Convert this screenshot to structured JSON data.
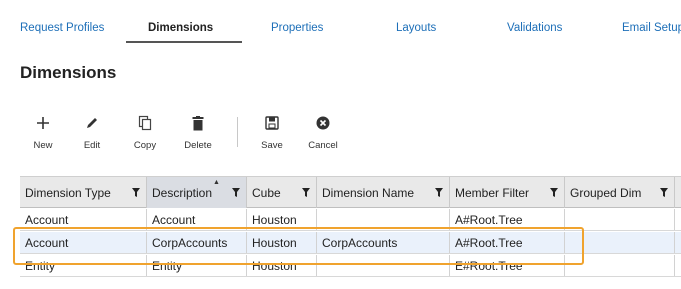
{
  "tabs": [
    {
      "label": "Request Profiles",
      "active": false
    },
    {
      "label": "Dimensions",
      "active": true
    },
    {
      "label": "Properties",
      "active": false
    },
    {
      "label": "Layouts",
      "active": false
    },
    {
      "label": "Validations",
      "active": false
    },
    {
      "label": "Email Setup",
      "active": false
    }
  ],
  "page_title": "Dimensions",
  "toolbar": {
    "new": {
      "label": "New",
      "icon": "plus-icon"
    },
    "edit": {
      "label": "Edit",
      "icon": "pencil-icon"
    },
    "copy": {
      "label": "Copy",
      "icon": "copy-icon"
    },
    "delete": {
      "label": "Delete",
      "icon": "trash-icon"
    },
    "save": {
      "label": "Save",
      "icon": "save-icon"
    },
    "cancel": {
      "label": "Cancel",
      "icon": "cancel-icon"
    }
  },
  "grid": {
    "columns": [
      {
        "label": "Dimension Type",
        "filter": true,
        "sorted": false
      },
      {
        "label": "Description",
        "filter": true,
        "sorted": true,
        "sort_direction": "ascending"
      },
      {
        "label": "Cube",
        "filter": true,
        "sorted": false
      },
      {
        "label": "Dimension Name",
        "filter": true,
        "sorted": false
      },
      {
        "label": "Member Filter",
        "filter": true,
        "sorted": false
      },
      {
        "label": "Grouped Dim",
        "filter": true,
        "sorted": false
      }
    ],
    "rows": [
      {
        "cells": [
          "Account",
          "Account",
          "Houston",
          "",
          "A#Root.Tree",
          ""
        ],
        "selected": false
      },
      {
        "cells": [
          "Account",
          "CorpAccounts",
          "Houston",
          "CorpAccounts",
          "A#Root.Tree",
          ""
        ],
        "selected": true
      },
      {
        "cells": [
          "Entity",
          "Entity",
          "Houston",
          "",
          "E#Root.Tree",
          ""
        ],
        "selected": false
      }
    ]
  },
  "colors": {
    "tab_link": "#1d6fb8",
    "highlight": "#f0a32e",
    "header_bg": "#e9e9e9",
    "selected_row": "#eaf1fb"
  }
}
